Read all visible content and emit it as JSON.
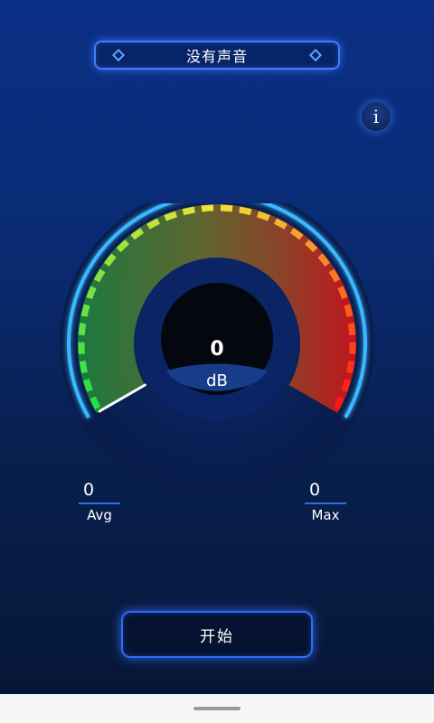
{
  "top_bar": {
    "mode_label": "没有声音"
  },
  "info_button": {
    "icon": "info-icon",
    "glyph": "i"
  },
  "meter": {
    "value": "0",
    "unit": "dB",
    "needle_fraction": 0,
    "colors": {
      "low": "#22e04a",
      "mid": "#f3e33a",
      "high": "#ff1616",
      "outer_ring": "#3ab8ff"
    }
  },
  "stats": {
    "avg": {
      "value": "0",
      "label": "Avg"
    },
    "max": {
      "value": "0",
      "label": "Max"
    }
  },
  "actions": {
    "start_label": "开始"
  }
}
